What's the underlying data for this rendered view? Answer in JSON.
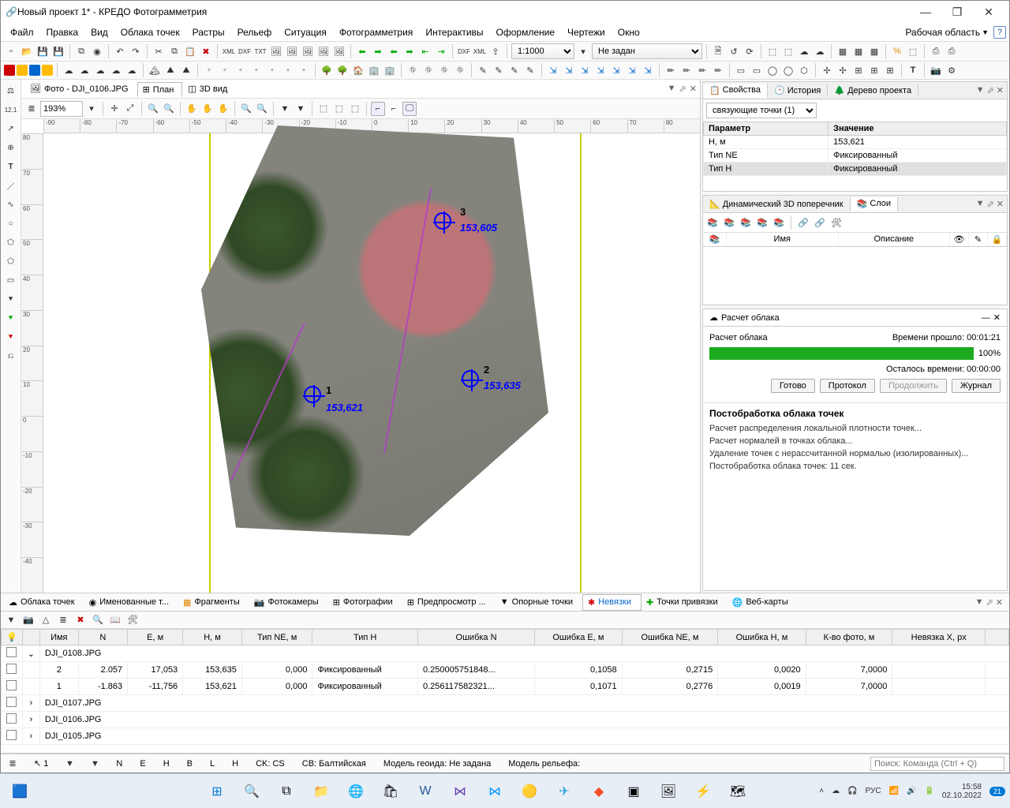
{
  "title": "Новый проект 1* - КРЕДО Фотограмметрия",
  "menu": [
    "Файл",
    "Правка",
    "Вид",
    "Облака точек",
    "Растры",
    "Рельеф",
    "Ситуация",
    "Фотограмметрия",
    "Интерактивы",
    "Оформление",
    "Чертежи",
    "Окно"
  ],
  "workspace": "Рабочая область",
  "scaleCombo": "1:1000",
  "modeCombo": "Не задан",
  "tabs": {
    "photo": "Фото - DJI_0106.JPG",
    "plan": "План",
    "view3d": "3D вид"
  },
  "zoom": "193%",
  "rulerTop": [
    "-90",
    "-80",
    "-70",
    "-60",
    "-50",
    "-40",
    "-30",
    "-20",
    "-10",
    "0",
    "10",
    "20",
    "30",
    "40",
    "50",
    "60",
    "70",
    "80"
  ],
  "rulerLeft": [
    "80",
    "70",
    "60",
    "50",
    "40",
    "30",
    "20",
    "10",
    "0",
    "-10",
    "-20",
    "-30",
    "-40"
  ],
  "markers": {
    "m1": {
      "num": "1",
      "label": "153,621"
    },
    "m2": {
      "num": "2",
      "label": "153,635"
    },
    "m3": {
      "num": "3",
      "label": "153,605"
    }
  },
  "propsPanel": {
    "tabs": {
      "props": "Свойства",
      "history": "История",
      "tree": "Дерево проекта"
    },
    "combo": "связующие точки (1)",
    "headParam": "Параметр",
    "headVal": "Значение",
    "rows": [
      {
        "p": "H, м",
        "v": "153,621"
      },
      {
        "p": "Тип NE",
        "v": "Фиксированный"
      },
      {
        "p": "Тип H",
        "v": "Фиксированный"
      }
    ]
  },
  "layersPanel": {
    "tabs": {
      "dyn": "Динамический 3D поперечник",
      "layers": "Слои"
    },
    "cols": {
      "name": "Имя",
      "desc": "Описание"
    }
  },
  "calc": {
    "title": "Расчет облака",
    "status": "Расчет облака",
    "elapsedLabel": "Времени прошло:",
    "elapsed": "00:01:21",
    "remainLabel": "Осталось времени:",
    "remain": "00:00:00",
    "pct": "100%",
    "btn_done": "Готово",
    "btn_proto": "Протокол",
    "btn_cont": "Продолжить",
    "btn_log": "Журнал",
    "log_title": "Постобработка облака точек",
    "log_lines": [
      "Расчет распределения локальной плотности точек...",
      "Расчет нормалей в точках облака...",
      "Удаление точек с нерассчитанной нормалью (изолированных)...",
      "Постобработка облака точек: 11 сек."
    ]
  },
  "bottomTabs": {
    "clouds": "Облака точек",
    "named": "Именованные т...",
    "frags": "Фрагменты",
    "cams": "Фотокамеры",
    "photos": "Фотографии",
    "preview": "Предпросмотр ...",
    "control": "Опорные точки",
    "resid": "Невязки",
    "tie": "Точки привязки",
    "webmaps": "Веб-карты"
  },
  "grid": {
    "cols": [
      "",
      "",
      "Имя",
      "N",
      "E, м",
      "H, м",
      "Тип NE, м",
      "Тип H",
      "Ошибка N",
      "Ошибка E, м",
      "Ошибка NE, м",
      "Ошибка H, м",
      "К-во фото, м",
      "Невязка X, px",
      ""
    ],
    "rows": [
      {
        "kind": "group",
        "name": "DJI_0108.JPG"
      },
      {
        "kind": "data",
        "name": "2",
        "n": "2.057",
        "e": "17,053",
        "h": "153,635",
        "tne": "0,000",
        "th": "Фиксированный",
        "en": "0.250005751848...",
        "ee": "0,1058",
        "ene": "0,2715",
        "eh": "0,0020",
        "cnt": "7,0000"
      },
      {
        "kind": "data",
        "name": "1",
        "n": "-1.863",
        "e": "-11,756",
        "h": "153,621",
        "tne": "0,000",
        "th": "Фиксированный",
        "en": "0.256117582321...",
        "ee": "0,1071",
        "ene": "0,2776",
        "eh": "0,0019",
        "cnt": "7,0000"
      },
      {
        "kind": "group",
        "name": "DJI_0107.JPG"
      },
      {
        "kind": "group",
        "name": "DJI_0106.JPG"
      },
      {
        "kind": "group",
        "name": "DJI_0105.JPG"
      }
    ]
  },
  "status": {
    "ck": "CK:",
    "ckv": "CS",
    "cv": "СВ:",
    "cvv": "Балтийская",
    "geoid": "Модель геоида:",
    "geoidv": "Не задана",
    "relief": "Модель рельефа:",
    "labels": [
      "N",
      "E",
      "H",
      "B",
      "L",
      "H"
    ],
    "num": "1",
    "searchPH": "Поиск: Команда (Ctrl + Q)"
  },
  "tray": {
    "lang": "РУС",
    "time": "15:58",
    "date": "02.10.2022",
    "badge": "21"
  }
}
